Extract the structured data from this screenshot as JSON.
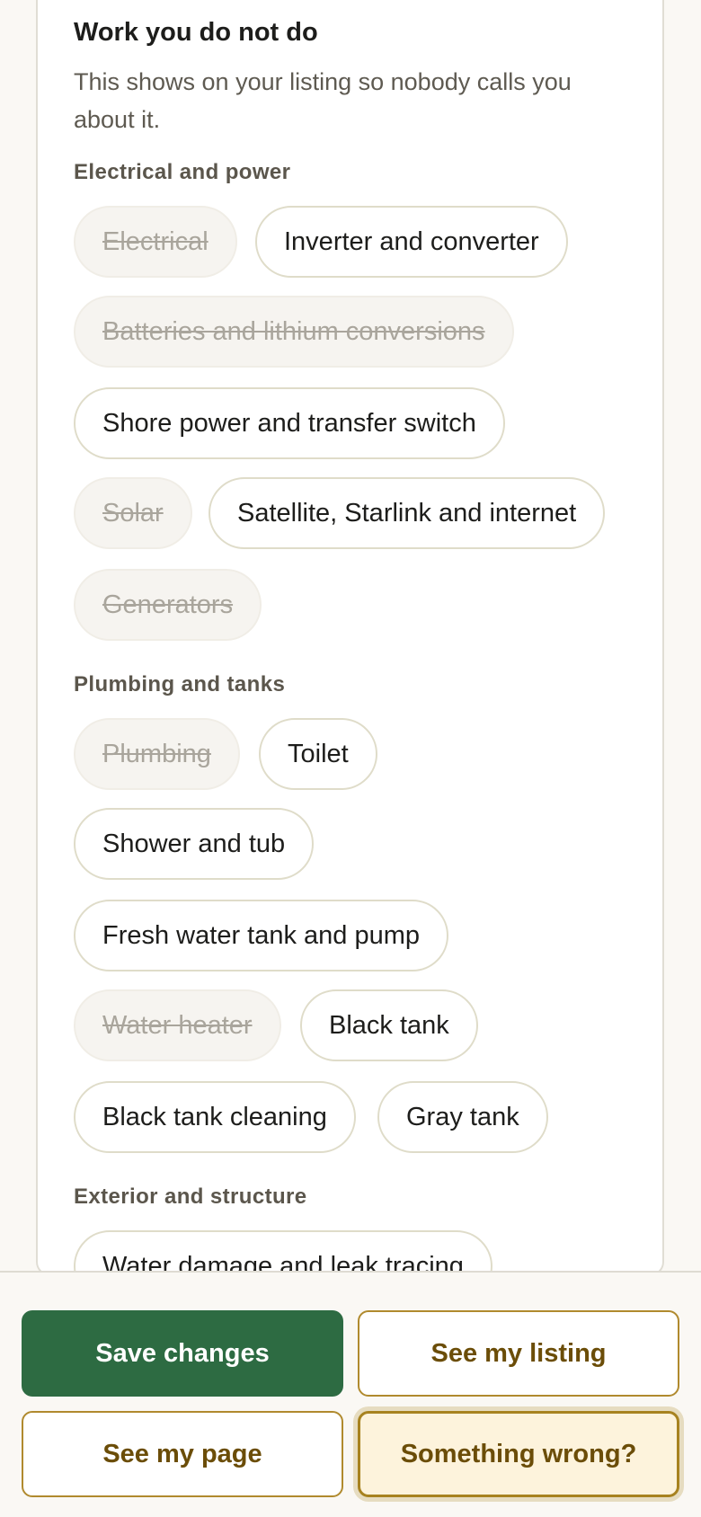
{
  "section": {
    "title": "Work you do not do",
    "description": "This shows on your listing so nobody calls you about it."
  },
  "groups": [
    {
      "heading": "Electrical and power",
      "chips": [
        {
          "label": "Electrical",
          "excluded": true
        },
        {
          "label": "Inverter and converter",
          "excluded": false
        },
        {
          "label": "Batteries and lithium conversions",
          "excluded": true
        },
        {
          "label": "Shore power and transfer switch",
          "excluded": false
        },
        {
          "label": "Solar",
          "excluded": true
        },
        {
          "label": "Satellite, Starlink and internet",
          "excluded": false
        },
        {
          "label": "Generators",
          "excluded": true
        }
      ]
    },
    {
      "heading": "Plumbing and tanks",
      "chips": [
        {
          "label": "Plumbing",
          "excluded": true
        },
        {
          "label": "Toilet",
          "excluded": false
        },
        {
          "label": "Shower and tub",
          "excluded": false
        },
        {
          "label": "Fresh water tank and pump",
          "excluded": false
        },
        {
          "label": "Water heater",
          "excluded": true
        },
        {
          "label": "Black tank",
          "excluded": false
        },
        {
          "label": "Black tank cleaning",
          "excluded": false
        },
        {
          "label": "Gray tank",
          "excluded": false
        }
      ]
    },
    {
      "heading": "Exterior and structure",
      "chips": [
        {
          "label": "Water damage and leak tracing",
          "excluded": false
        }
      ]
    }
  ],
  "actions": {
    "save": "Save changes",
    "see_listing": "See my listing",
    "see_page": "See my page",
    "something_wrong": "Something wrong?"
  }
}
